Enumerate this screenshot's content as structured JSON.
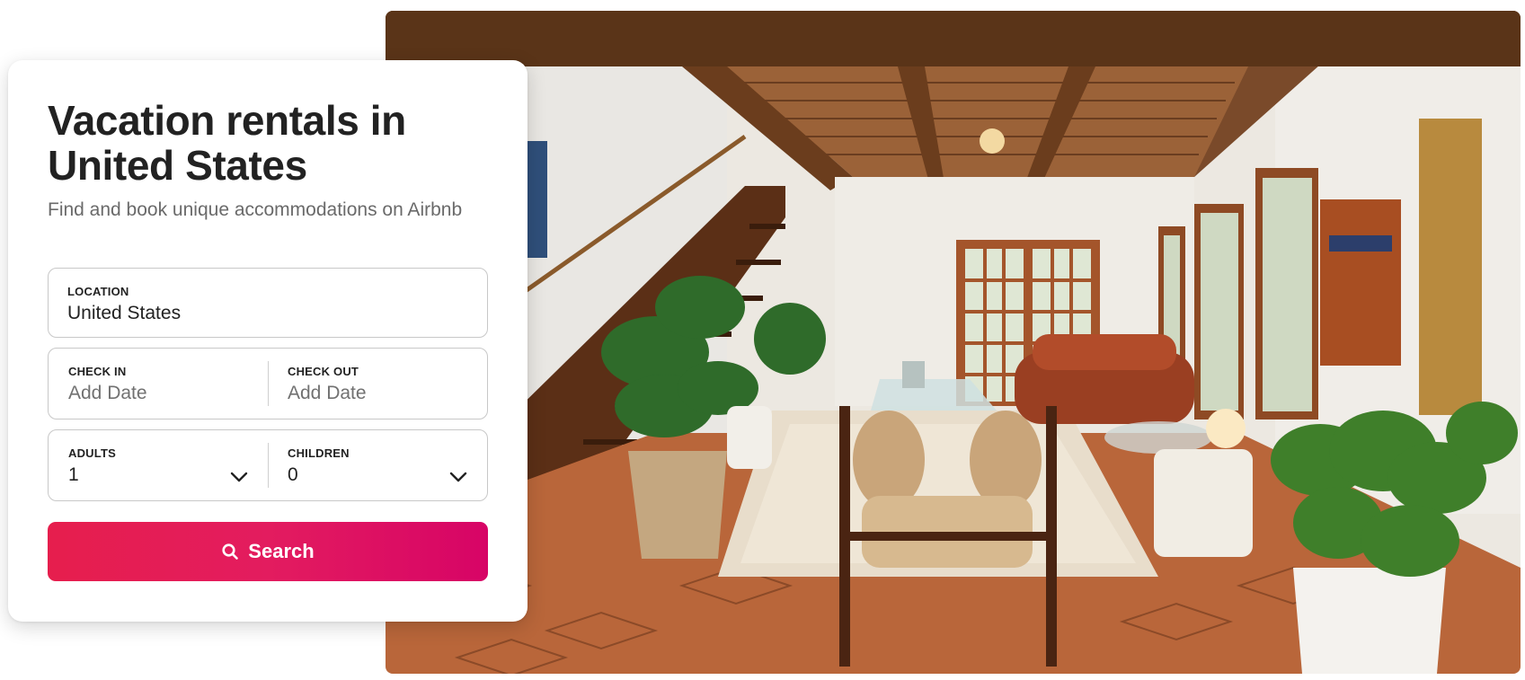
{
  "card": {
    "title": "Vacation rentals in United States",
    "subtitle": "Find and book unique accommodations on Airbnb"
  },
  "location": {
    "label": "LOCATION",
    "value": "United States"
  },
  "check_in": {
    "label": "CHECK IN",
    "placeholder": "Add Date"
  },
  "check_out": {
    "label": "CHECK OUT",
    "placeholder": "Add Date"
  },
  "adults": {
    "label": "ADULTS",
    "value": "1"
  },
  "children": {
    "label": "CHILDREN",
    "value": "0"
  },
  "search_button": {
    "label": "Search"
  },
  "colors": {
    "brand_gradient_start": "#e61e4d",
    "brand_gradient_end": "#d70466",
    "text": "#222222",
    "muted": "#6a6a6a"
  },
  "icons": [
    "search-icon",
    "chevron-down-icon"
  ]
}
